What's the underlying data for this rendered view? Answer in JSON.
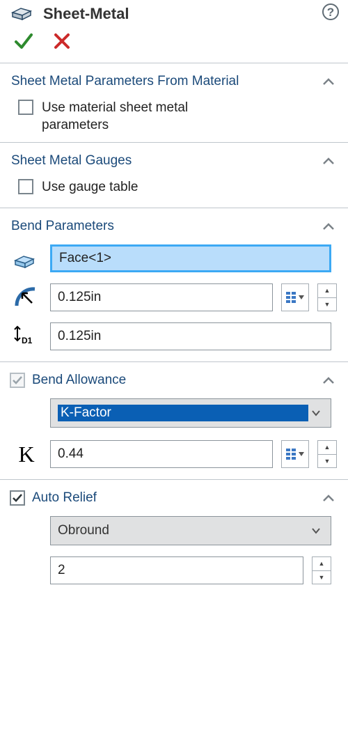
{
  "header": {
    "title": "Sheet-Metal"
  },
  "sections": {
    "from_material": {
      "title": "Sheet Metal Parameters From Material",
      "use_material": "Use material sheet metal parameters"
    },
    "gauges": {
      "title": "Sheet Metal Gauges",
      "use_gauge": "Use gauge table"
    },
    "bend_params": {
      "title": "Bend Parameters",
      "face": "Face<1>",
      "radius": "0.125in",
      "thickness": "0.125in"
    },
    "bend_allowance": {
      "title": "Bend Allowance",
      "method": "K-Factor",
      "k": "0.44"
    },
    "auto_relief": {
      "title": "Auto Relief",
      "type": "Obround",
      "ratio": "2"
    }
  }
}
